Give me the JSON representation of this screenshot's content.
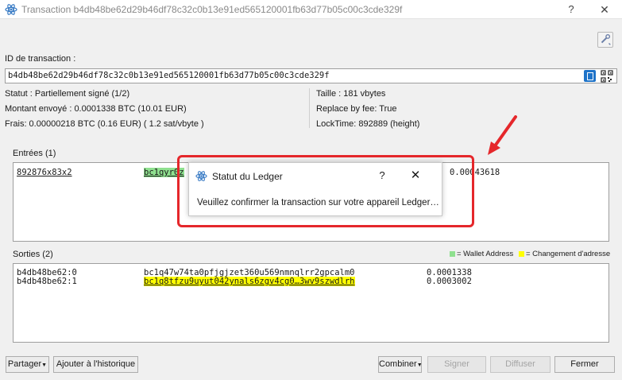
{
  "window": {
    "title": "Transaction b4db48be62d29b46df78c32c0b13e91ed565120001fb63d77b05c00c3cde329f",
    "help_label": "?",
    "close_label": "✕"
  },
  "txid": {
    "label": "ID de transaction :",
    "value": "b4db48be62d29b46df78c32c0b13e91ed565120001fb63d77b05c00c3cde329f"
  },
  "info_left": {
    "status": "Statut : Partiellement signé (1/2)",
    "amount": "Montant envoyé : 0.0001338 BTC (10.01 EUR)",
    "fee": "Frais: 0.00000218 BTC (0.16 EUR)  ( 1.2 sat/vbyte )"
  },
  "info_right": {
    "size": "Taille : 181 vbytes",
    "rbf": "Replace by fee: True",
    "locktime": "LockTime: 892889 (height)"
  },
  "inputs": {
    "header": "Entrées (1)",
    "rows": [
      {
        "ref": "892876x83x2",
        "address": "bc1qyr0z",
        "amount": "0.00043618"
      }
    ]
  },
  "outputs": {
    "header": "Sorties (2)",
    "legend_wallet": "= Wallet Address",
    "legend_change": "= Changement d'adresse",
    "rows": [
      {
        "ref": "b4db48be62:0",
        "address": "bc1q47w74ta0pfjgjzet360u569nmnqlrr2gpcalm0",
        "amount": "0.0001338"
      },
      {
        "ref": "b4db48be62:1",
        "address": "bc1q8tfzu9uyut042ynals6zgv4cg0…3wv9szwdlrh",
        "amount": "0.0003002"
      }
    ]
  },
  "dialog": {
    "title": "Statut du Ledger",
    "help_label": "?",
    "close_label": "✕",
    "message": "Veuillez confirmer la transaction sur votre appareil Ledger…"
  },
  "buttons": {
    "share": "Partager",
    "add_history": "Ajouter à l'historique",
    "combine": "Combiner",
    "sign": "Signer",
    "broadcast": "Diffuser",
    "close": "Fermer"
  },
  "colors": {
    "wallet_highlight": "#8fe08f",
    "change_highlight": "#ffff00",
    "annotation_red": "#e5272b",
    "accent_blue": "#1e73c8"
  },
  "icons": {
    "app": "electrum-icon",
    "copy": "copy-icon",
    "qr": "qr-code-icon",
    "tool": "tools-icon"
  }
}
